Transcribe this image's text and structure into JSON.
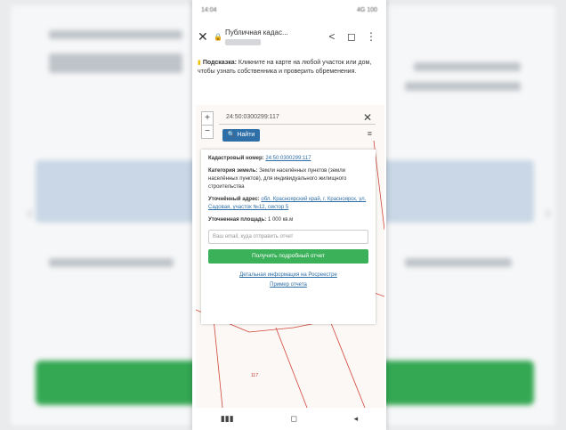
{
  "status_bar": {
    "time": "14:04",
    "right": "4G 100"
  },
  "browser": {
    "title": "Публичная кадас...",
    "icons": [
      "close-icon",
      "lock-icon",
      "share-icon",
      "bookmark-icon",
      "more-icon"
    ]
  },
  "hint": {
    "label": "Подсказка:",
    "text": "Кликните на карте на любой участок или дом, чтобы узнать собственника и проверить обременения."
  },
  "map_controls": {
    "zoom_in": "+",
    "zoom_out": "−",
    "search_value": "24:50:0300299:117",
    "find_button": "Найти"
  },
  "info_card": {
    "cadastral_label": "Кадастровый номер:",
    "cadastral_value": "24:50:0300299:117",
    "category_label": "Категория земель:",
    "category_value": "Земли населённых пунктов (земли населённых пунктов), для индивидуального жилищного строительства",
    "address_label": "Уточнённый адрес:",
    "address_value": "обл. Красноярский край, г. Красноярск, ул. Садовая, участок №12, сектор 5",
    "area_label": "Уточненная площадь:",
    "area_value": "1 000 кв.м",
    "input_placeholder": "Ваш email, куда отправить отчет",
    "order_button": "Получить подробный отчет",
    "link_1": "Детальная информация на Росреестре",
    "link_2": "Пример отчета"
  },
  "map_labels": {
    "parcel": "117"
  }
}
